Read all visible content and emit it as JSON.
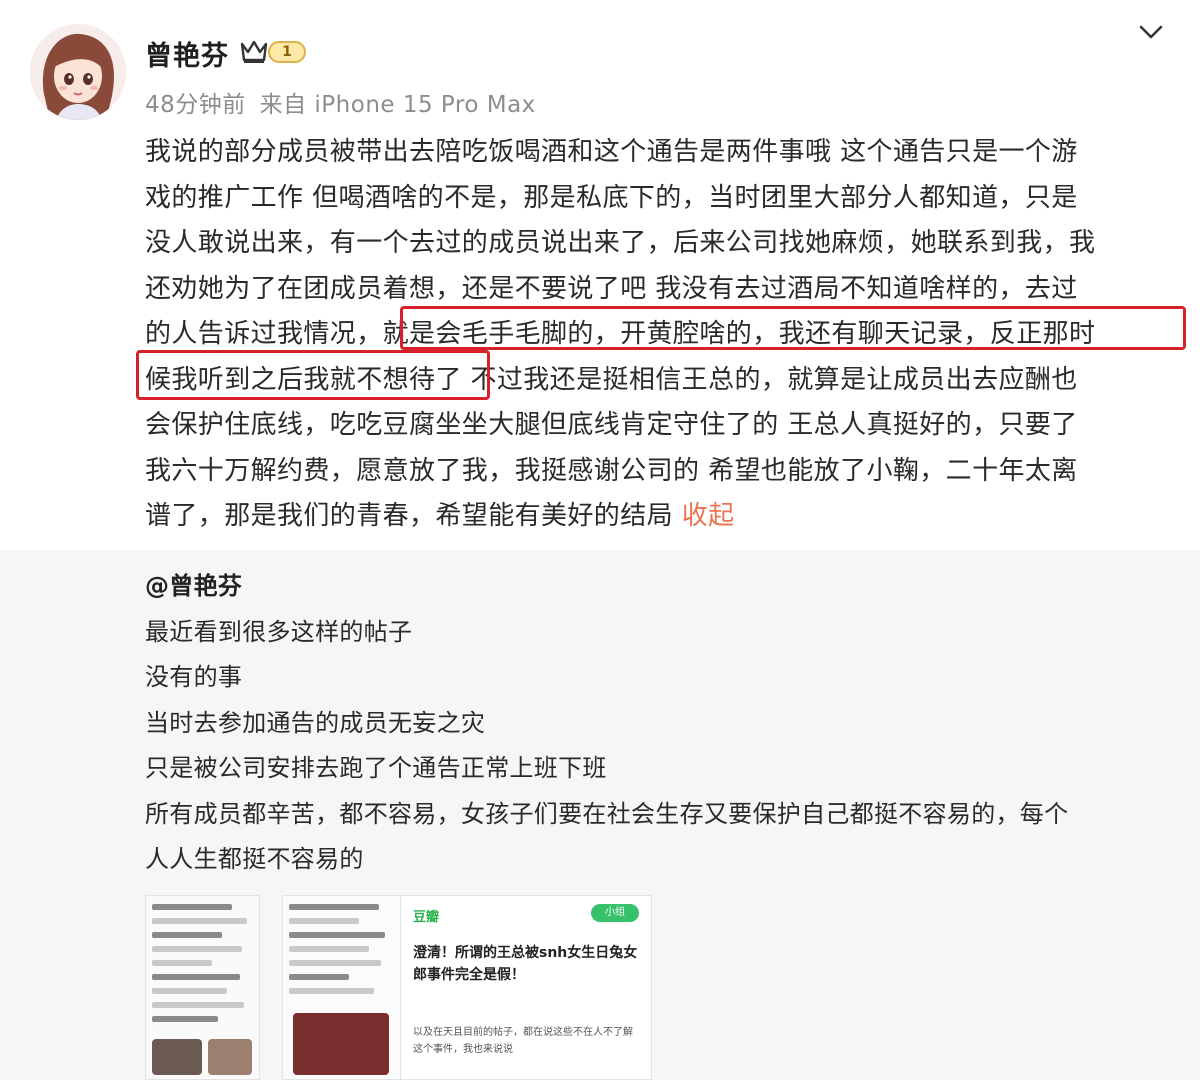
{
  "post": {
    "author": "曾艳芬",
    "level": "1",
    "time_ago": "48分钟前",
    "source": "来自 iPhone 15 Pro Max",
    "lines": [
      "我说的部分成员被带出去陪吃饭喝酒和这个通告是两件事哦 这个通告只是一个游",
      "戏的推广工作 但喝酒啥的不是，那是私底下的，当时团里大部分人都知道，只是",
      "没人敢说出来，有一个去过的成员说出来了，后来公司找她麻烦，她联系到我，我",
      "还劝她为了在团成员着想，还是不要说了吧 我没有去过酒局不知道啥样的，去过",
      "的人告诉过我情况，就是会毛手毛脚的，开黄腔啥的，我还有聊天记录，反正那时",
      "候我听到之后我就不想待了 不过我还是挺相信王总的，就算是让成员出去应酬也",
      "会保护住底线，吃吃豆腐坐坐大腿但底线肯定守住了的 王总人真挺好的，只要了",
      "我六十万解约费，愿意放了我，我挺感谢公司的 希望也能放了小鞠，二十年太离"
    ],
    "last_line": "谱了，那是我们的青春，希望能有美好的结局",
    "collapse_label": "收起"
  },
  "repost": {
    "mention": "@曾艳芬",
    "lines": [
      "最近看到很多这样的帖子",
      "没有的事",
      "当时去参加通告的成员无妄之灾",
      "只是被公司安排去跑了个通告正常上班下班",
      "所有成员都辛苦，都不容易，女孩子们要在社会生存又要保护自己都挺不容易的，每个",
      "人人生都挺不容易的"
    ]
  },
  "thumbnails": {
    "t3_brand": "豆瓣",
    "t3_tag": "小组",
    "t3_title": "澄清！所谓的王总被snh女生日兔女郎事件完全是假！",
    "t3_body": "以及在天且目前的帖子，都在说这些不在人不了解这个事件，我也来说说"
  },
  "colors": {
    "highlight_box": "#d8202a",
    "link": "#eb7350",
    "meta": "#8d8d8d"
  },
  "icons": [
    "chevron-down-icon",
    "crown-icon"
  ]
}
